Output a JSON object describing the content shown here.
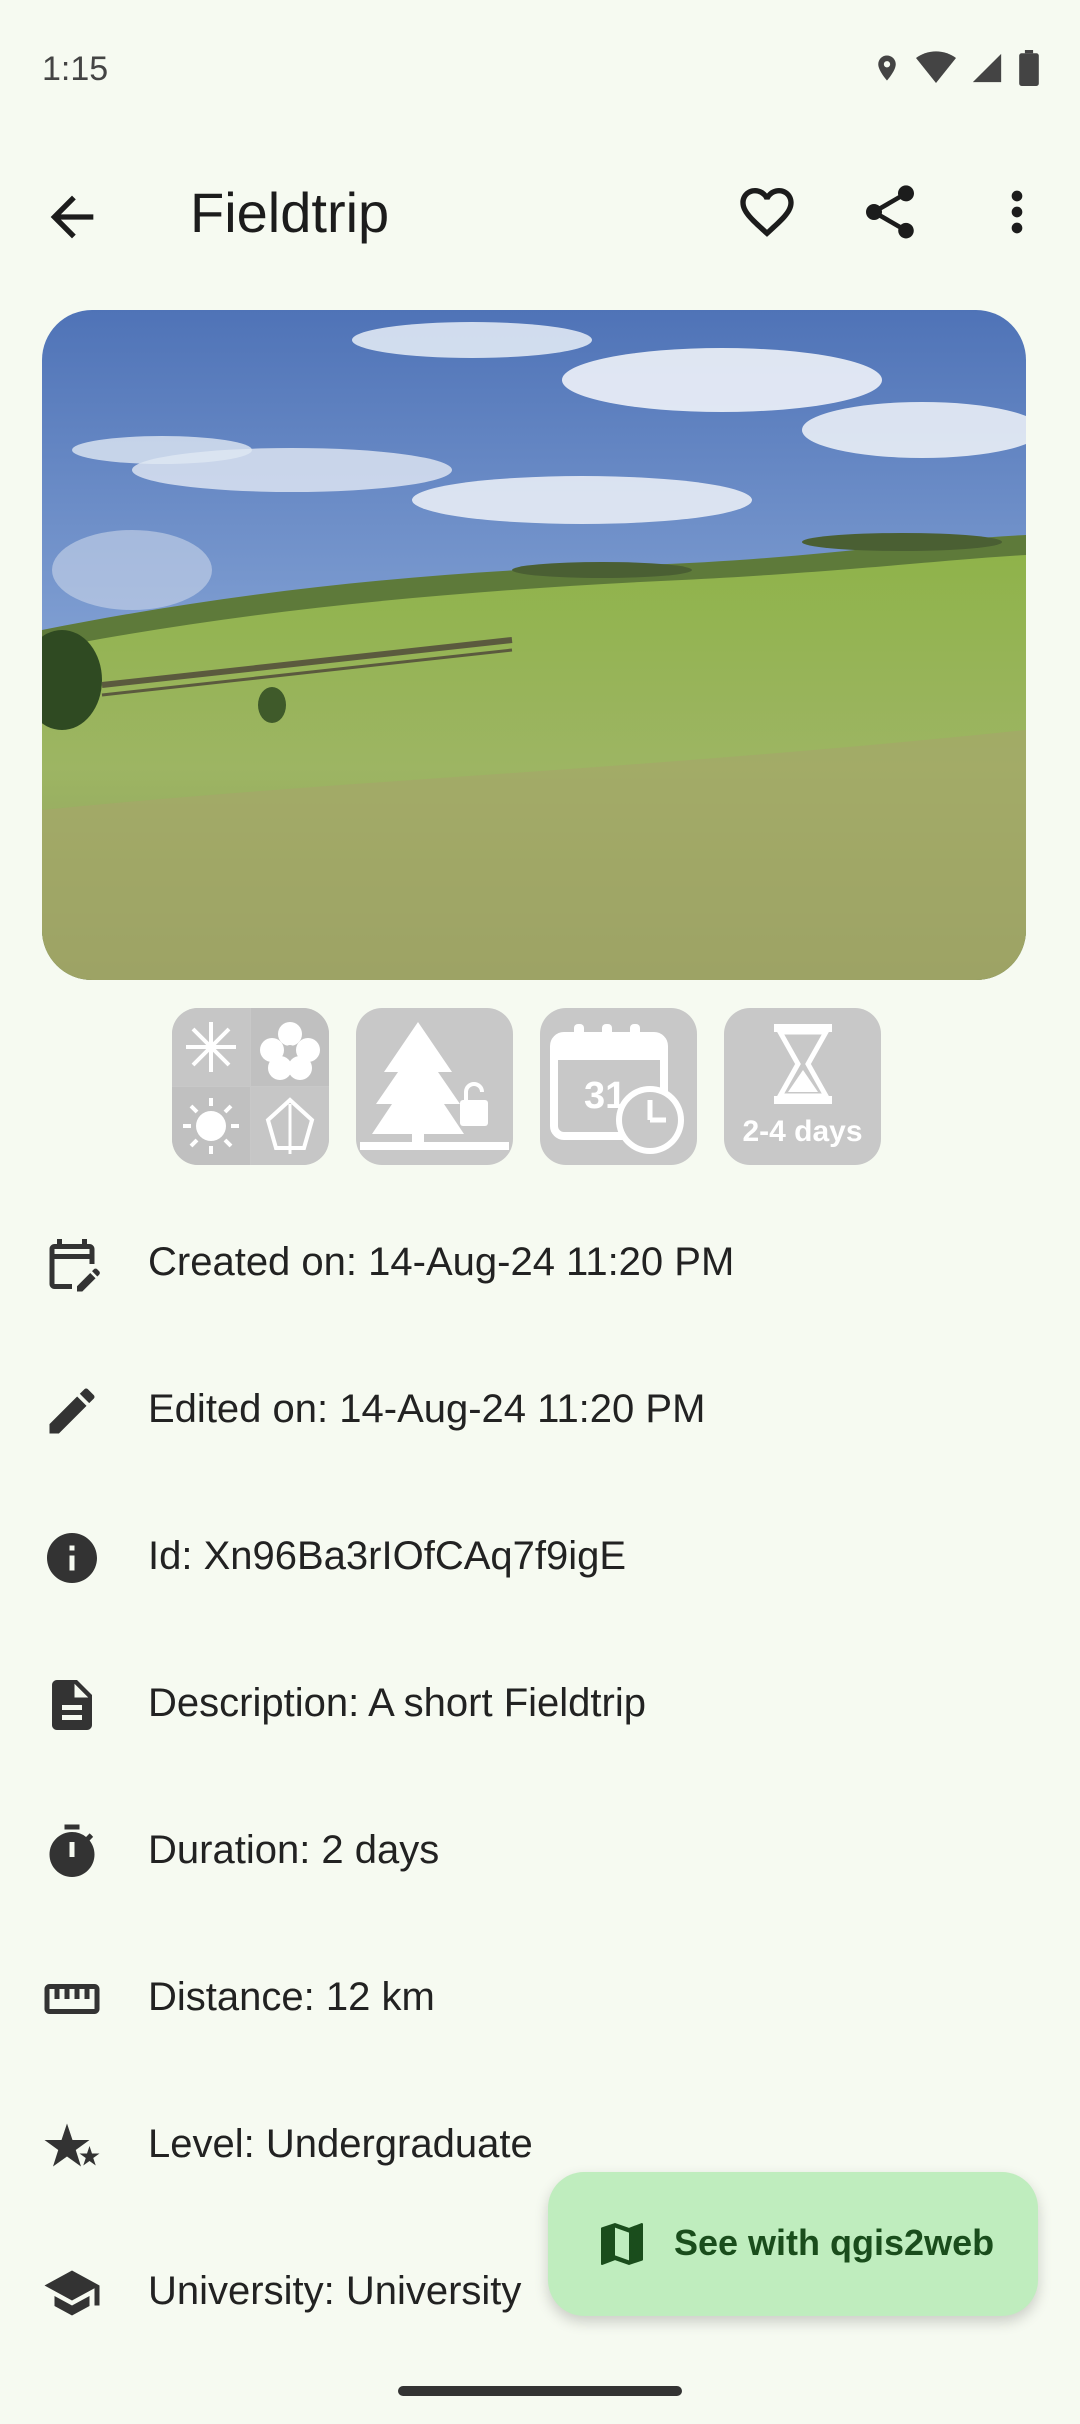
{
  "status_bar": {
    "time": "1:15"
  },
  "app_bar": {
    "title": "Fieldtrip"
  },
  "badges": [
    {
      "name": "seasons",
      "text": ""
    },
    {
      "name": "nature-locked",
      "text": ""
    },
    {
      "name": "calendar-time",
      "text": ""
    },
    {
      "name": "duration",
      "text": "2-4 days"
    }
  ],
  "details": [
    {
      "icon": "calendar-edit-icon",
      "text": "Created on: 14-Aug-24 11:20 PM"
    },
    {
      "icon": "pencil-icon",
      "text": "Edited on: 14-Aug-24 11:20 PM"
    },
    {
      "icon": "info-icon",
      "text": "Id: Xn96Ba3rIOfCAq7f9igE"
    },
    {
      "icon": "document-icon",
      "text": "Description: A short Fieldtrip"
    },
    {
      "icon": "timer-icon",
      "text": "Duration: 2 days"
    },
    {
      "icon": "ruler-icon",
      "text": "Distance: 12 km"
    },
    {
      "icon": "star-level-icon",
      "text": "Level: Undergraduate"
    },
    {
      "icon": "school-icon",
      "text": "University: University"
    }
  ],
  "fab": {
    "label": "See with qgis2web",
    "icon": "map-icon"
  },
  "colors": {
    "background": "#f6faf1",
    "fab_background": "#bfedbe",
    "fab_text": "#1a4d1c",
    "badge_background": "#c8c8c8"
  }
}
